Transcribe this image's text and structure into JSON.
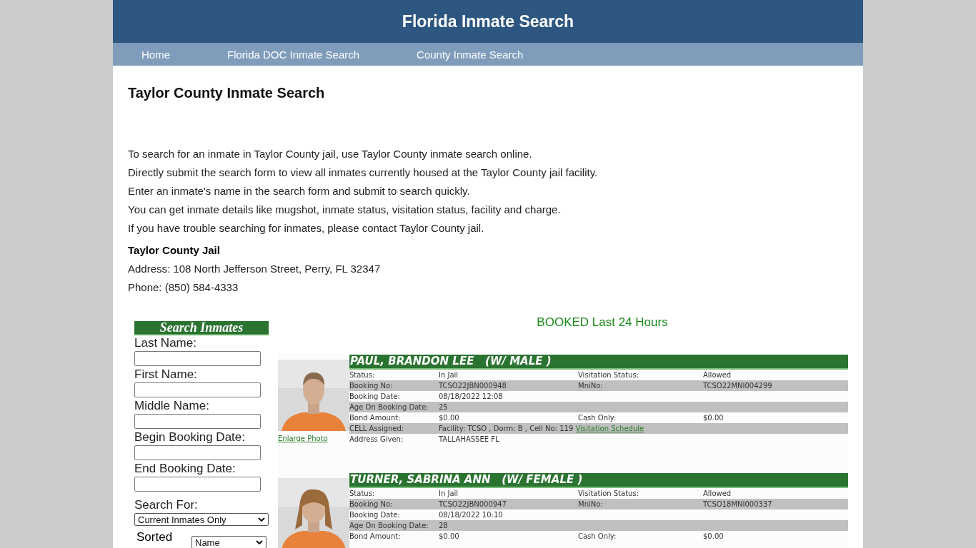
{
  "site_title": "Florida Inmate Search",
  "nav": [
    {
      "label": "Home"
    },
    {
      "label": "Florida DOC Inmate Search"
    },
    {
      "label": "County Inmate Search"
    }
  ],
  "heading": "Taylor County Inmate Search",
  "paragraphs": [
    "To search for an inmate in Taylor County jail, use Taylor County inmate search online.",
    "Directly submit the search form to view all inmates currently housed at the Taylor County jail facility.",
    "Enter an inmate's name in the search form and submit to search quickly.",
    "You can get inmate details like mugshot, inmate status, visitation status, facility and charge.",
    "If you have trouble searching for inmates, please contact Taylor County jail."
  ],
  "jail": {
    "name": "Taylor County Jail",
    "address": "Address: 108 North Jefferson Street, Perry, FL 32347",
    "phone": "Phone: (850) 584-4333"
  },
  "search_form": {
    "title": "Search Inmates",
    "fields": [
      {
        "label": "Last Name:"
      },
      {
        "label": "First Name:"
      },
      {
        "label": "Middle Name:"
      },
      {
        "label": "Begin Booking Date:"
      },
      {
        "label": "End Booking Date:"
      }
    ],
    "search_for": {
      "label": "Search For:",
      "value": "Current Inmates Only"
    },
    "sorted": {
      "label": "Sorted",
      "value": "Name"
    }
  },
  "results": {
    "title": "BOOKED Last 24 Hours",
    "inmates": [
      {
        "name": "PAUL, BRANDON LEE   (W/ MALE )",
        "photo_link": "Enlarge Photo",
        "rows": [
          {
            "label": "Status:",
            "value": "In Jail",
            "label_2": "Visitation Status:",
            "value_2": "Allowed"
          },
          {
            "label": "Booking No:",
            "value": "TCSO22JBN000948",
            "label_2": "MniNo:",
            "value_2": "TCSO22MNI004299"
          },
          {
            "label": "Booking Date:",
            "value": "08/18/2022 12:08"
          },
          {
            "label": "Age On Booking Date:",
            "value": "25"
          },
          {
            "label": "Bond Amount:",
            "value": "$0.00",
            "label_2": "Cash Only:",
            "value_2": "$0.00"
          },
          {
            "label": "CELL Assigned:",
            "value": "Facility: TCSO , Dorm: B , Cell No: 119",
            "link": "Visitation Schedule"
          },
          {
            "label": "Address Given:",
            "value": "TALLAHASSEE FL"
          }
        ]
      },
      {
        "name": "TURNER, SABRINA ANN   (W/ FEMALE )",
        "rows": [
          {
            "label": "Status:",
            "value": "In Jail",
            "label_2": "Visitation Status:",
            "value_2": "Allowed"
          },
          {
            "label": "Booking No:",
            "value": "TCSO22JBN000947",
            "label_2": "MniNo:",
            "value_2": "TCSO18MNI000337"
          },
          {
            "label": "Booking Date:",
            "value": "08/18/2022 10:10"
          },
          {
            "label": "Age On Booking Date:",
            "value": "28"
          },
          {
            "label": "Bond Amount:",
            "value": "$0.00",
            "label_2": "Cash Only:",
            "value_2": "$0.00"
          }
        ]
      }
    ]
  }
}
